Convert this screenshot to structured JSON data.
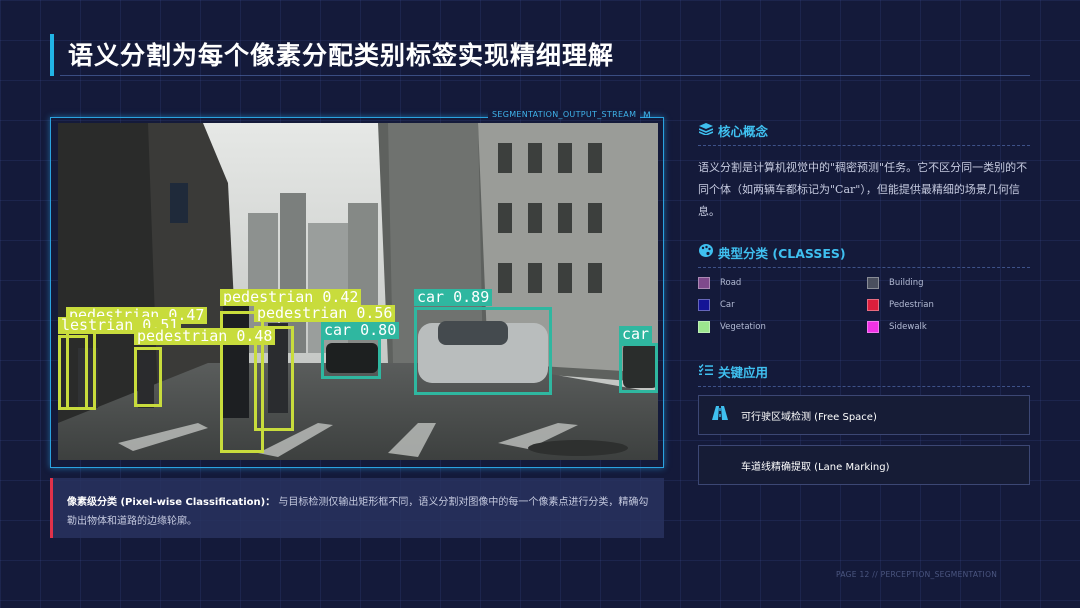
{
  "title": "语义分割为每个像素分配类别标签实现精细理解",
  "stream_label": "SEGMENTATION_OUTPUT_STREAM",
  "stream_mark": "M",
  "detections": [
    {
      "label": "pedestrian 0.47",
      "color": "#c8dc3c"
    },
    {
      "label": "lestrian 0.51",
      "color": "#c8dc3c"
    },
    {
      "label": "pedestrian 0.42",
      "color": "#c8dc3c"
    },
    {
      "label": "pedestrian 0.56",
      "color": "#c8dc3c"
    },
    {
      "label": "pedestrian 0.48",
      "color": "#c8dc3c"
    },
    {
      "label": "car 0.89",
      "color": "#2fb7a0"
    },
    {
      "label": "car 0.80",
      "color": "#2fb7a0"
    },
    {
      "label": "car",
      "color": "#2fb7a0"
    }
  ],
  "note": {
    "bold": "像素级分类 (Pixel-wise Classification)：",
    "text": "与目标检测仅输出矩形框不同，语义分割对图像中的每一个像素点进行分类，精确勾勒出物体和道路的边缘轮廓。"
  },
  "concept": {
    "heading": "核心概念",
    "icon": "layers-icon",
    "text": "语义分割是计算机视觉中的\"稠密预测\"任务。它不区分同一类别的不同个体（如两辆车都标记为\"Car\"），但能提供最精细的场景几何信息。"
  },
  "classes": {
    "heading": "典型分类 (CLASSES)",
    "icon": "palette-icon",
    "items": [
      {
        "name": "Road",
        "color": "#7f4a8c"
      },
      {
        "name": "Building",
        "color": "#4a4f5e"
      },
      {
        "name": "Car",
        "color": "#141496"
      },
      {
        "name": "Pedestrian",
        "color": "#dc1e3c"
      },
      {
        "name": "Vegetation",
        "color": "#9ce68e"
      },
      {
        "name": "Sidewalk",
        "color": "#f032e6"
      }
    ]
  },
  "applications": {
    "heading": "关键应用",
    "icon": "checklist-icon",
    "items": [
      {
        "label": "可行驶区域检测 (Free Space)",
        "icon": "road-icon"
      },
      {
        "label": "车道线精确提取 (Lane Marking)",
        "icon": ""
      }
    ]
  },
  "footer": "PAGE 12 // PERCEPTION_SEGMENTATION"
}
